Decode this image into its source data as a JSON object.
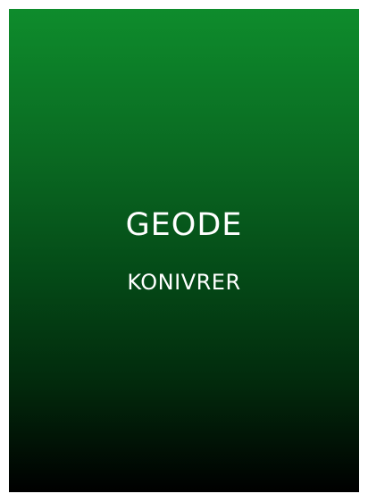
{
  "card": {
    "title": "GEODE",
    "subtitle": "KONIVRER"
  },
  "colors": {
    "gradient_top": "#0e8c2c",
    "gradient_bottom": "#000000",
    "text": "#ffffff"
  }
}
